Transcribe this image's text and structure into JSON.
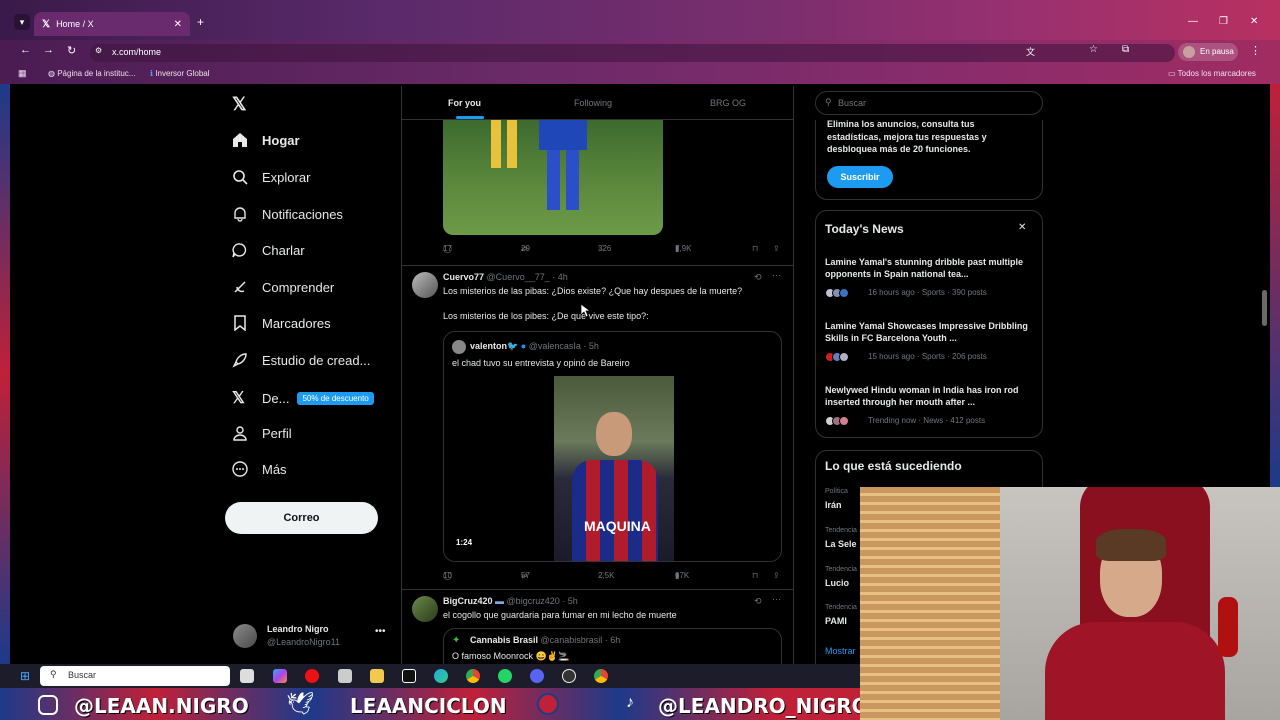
{
  "browser": {
    "tab_title": "Home / X",
    "url": "x.com/home",
    "profile_label": "En pausa",
    "bookmarks": [
      "Página de la instituc...",
      "Inversor Global"
    ],
    "all_bookmarks": "Todos los marcadores"
  },
  "sidebar": {
    "items": [
      {
        "label": "Hogar"
      },
      {
        "label": "Explorar"
      },
      {
        "label": "Notificaciones"
      },
      {
        "label": "Charlar"
      },
      {
        "label": "Comprender"
      },
      {
        "label": "Marcadores"
      },
      {
        "label": "Estudio de cread..."
      },
      {
        "label": "De..."
      },
      {
        "label": "Perfil"
      },
      {
        "label": "Más"
      }
    ],
    "premium_badge": "50% de descuento",
    "post_button": "Correo",
    "account": {
      "name": "Leandro Nigro",
      "handle": "@LeandroNigro11"
    }
  },
  "feed": {
    "tabs": [
      "For you",
      "Following",
      "BRG OG"
    ],
    "tweet0_stats": {
      "replies": "17",
      "retweets": "29",
      "likes": "326",
      "views": "7,9K"
    },
    "tweet1": {
      "name": "Cuervo77",
      "handle": "@Cuervo__77_",
      "time": "· 4h",
      "line1": "Los misterios de las pibas: ¿Dios existe? ¿Que hay despues de la muerte?",
      "line2": "Los misterios de los pibes: ¿De que vive este tipo?:",
      "quote": {
        "name": "valenton🐦",
        "handle": "@valencasIa",
        "time": "· 5h",
        "text": "el chad tuvo su entrevista y opinó de Bareiro",
        "duration": "1:24",
        "shirt_text": "MAQUINA"
      },
      "stats": {
        "replies": "10",
        "retweets": "57",
        "likes": "2,5K",
        "views": "67K"
      }
    },
    "tweet2": {
      "name": "BigCruz420",
      "handle": "@bigcruz420",
      "time": "· 5h",
      "text": "el cogollo que guardaria para fumar en mi lecho de muerte",
      "quote_name": "Cannabis Brasil",
      "quote_handle": "@canabisbrasil",
      "quote_time": "· 6h",
      "quote_text": "O famoso Moonrock 😄✌️🚬"
    }
  },
  "right": {
    "search_placeholder": "Buscar",
    "premium_text": "Elimina los anuncios, consulta tus estadísticas, mejora tus respuestas y desbloquea más de 20 funciones.",
    "subscribe": "Suscribir",
    "news_header": "Today's News",
    "news": [
      {
        "title": "Lamine Yamal's stunning dribble past multiple opponents in Spain national tea...",
        "meta": "16 hours ago · Sports · 390 posts"
      },
      {
        "title": "Lamine Yamal Showcases Impressive Dribbling Skills in FC Barcelona Youth ...",
        "meta": "15 hours ago · Sports · 206 posts"
      },
      {
        "title": "Newlywed Hindu woman in India has iron rod inserted through her mouth after ...",
        "meta": "Trending now · News · 412 posts"
      }
    ],
    "trends_header": "Lo que está sucediendo",
    "trends": [
      {
        "cat": "Política",
        "name": "Irán"
      },
      {
        "cat": "Tendencia",
        "name": "La Sele"
      },
      {
        "cat": "Tendencia",
        "name": "Lucio"
      },
      {
        "cat": "Tendencia",
        "name": "PAMI"
      }
    ],
    "show_more": "Mostrar"
  },
  "taskbar": {
    "search": "Buscar"
  },
  "banner": {
    "left": "@LEAAN.NIGRO",
    "middle": "LEAANCICLON",
    "right": "@LEANDRO_NIGRO"
  }
}
